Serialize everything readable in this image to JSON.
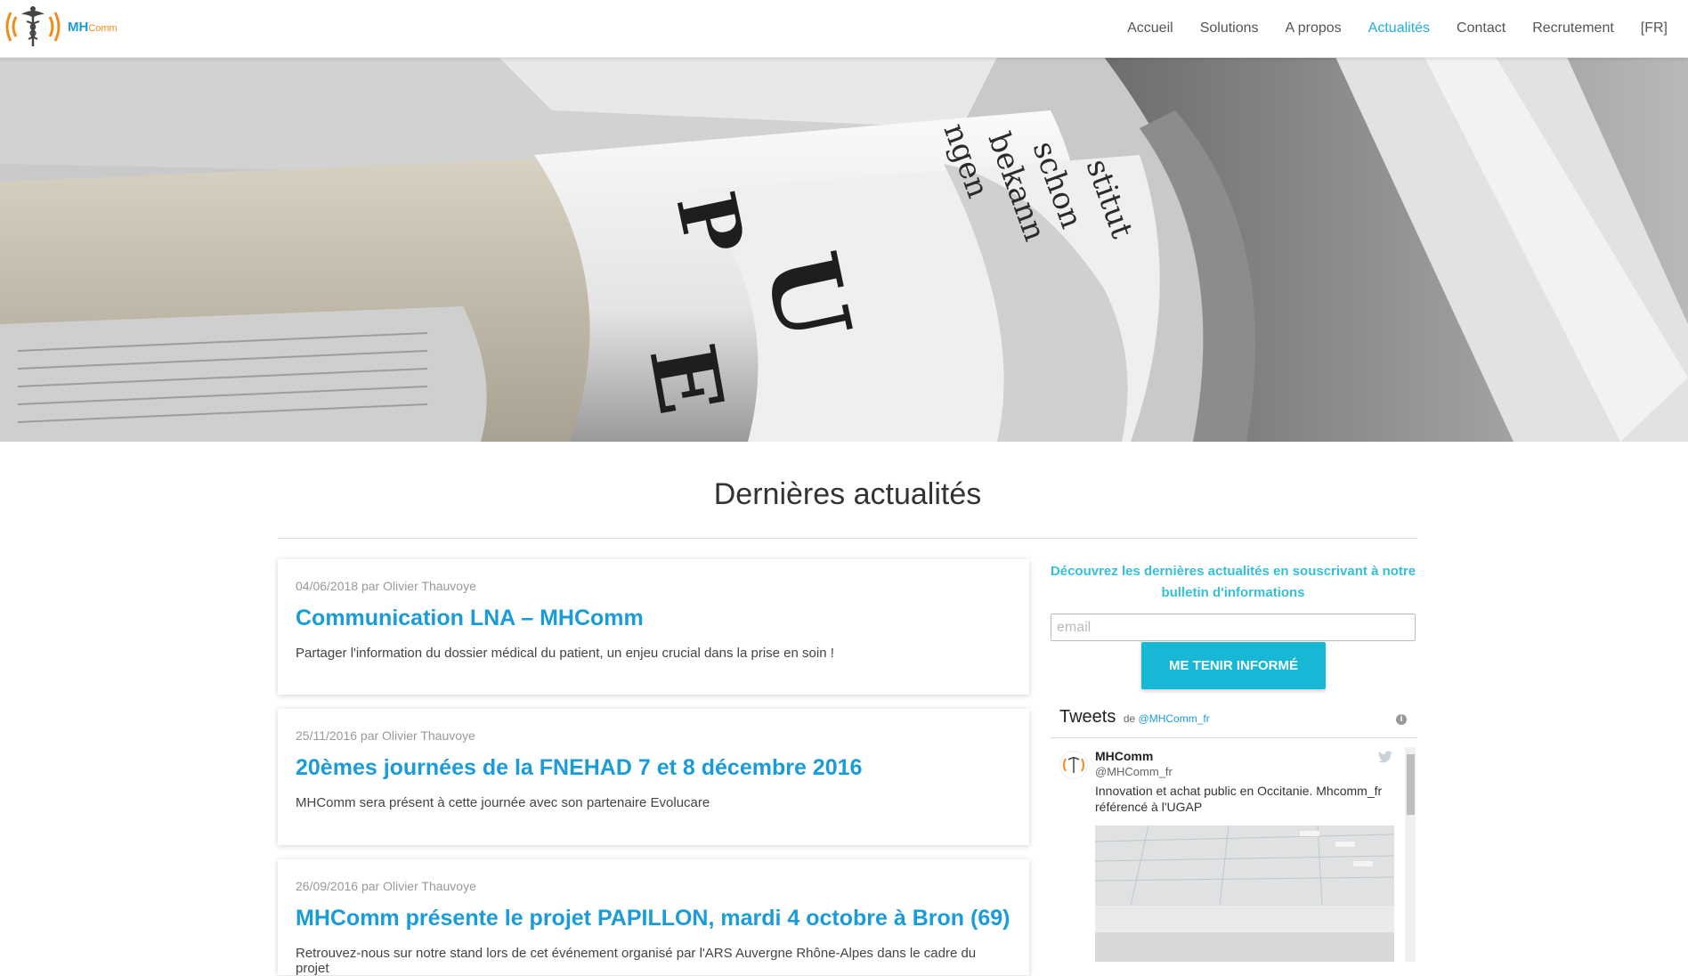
{
  "brand": {
    "name_primary": "MH",
    "name_secondary": "Comm",
    "colors": {
      "primary": "#1a9cd8",
      "accent": "#f28c1a",
      "teal": "#17b8d6"
    }
  },
  "nav": {
    "items": [
      {
        "label": "Accueil"
      },
      {
        "label": "Solutions"
      },
      {
        "label": "A propos"
      },
      {
        "label": "Actualités",
        "active": true
      },
      {
        "label": "Contact"
      },
      {
        "label": "Recrutement"
      },
      {
        "label": "[FR]"
      }
    ]
  },
  "hero": {
    "image": "newspapers-stack"
  },
  "main": {
    "title": "Dernières actualités",
    "posts": [
      {
        "meta": "04/06/2018 par Olivier Thauvoye",
        "title": "Communication LNA – MHComm",
        "excerpt": "Partager l'information du dossier médical du patient, un enjeu crucial dans la prise en soin !"
      },
      {
        "meta": "25/11/2016 par Olivier Thauvoye",
        "title": "20èmes journées de la FNEHAD 7 et 8 décembre 2016",
        "excerpt": "MHComm sera présent à cette journée avec son partenaire Evolucare"
      },
      {
        "meta": "26/09/2016 par Olivier Thauvoye",
        "title": "MHComm présente le projet PAPILLON, mardi 4 octobre à Bron (69)",
        "excerpt": "Retrouvez-nous sur notre stand lors de cet événement organisé par l'ARS Auvergne Rhône-Alpes dans le cadre du projet"
      }
    ]
  },
  "sidebar": {
    "newsletter_text": "Découvrez les dernières actualités en souscrivant à notre bulletin d'informations",
    "email_placeholder": "email",
    "subscribe_label": "ME TENIR INFORMÉ",
    "tweets": {
      "title": "Tweets",
      "by_prefix": "de",
      "handle": "@MHComm_fr",
      "info_icon": "i",
      "tweet": {
        "name": "MHComm",
        "handle": "@MHComm_fr",
        "text": "Innovation et achat public en Occitanie. Mhcomm_fr référencé à l'UGAP"
      }
    }
  }
}
